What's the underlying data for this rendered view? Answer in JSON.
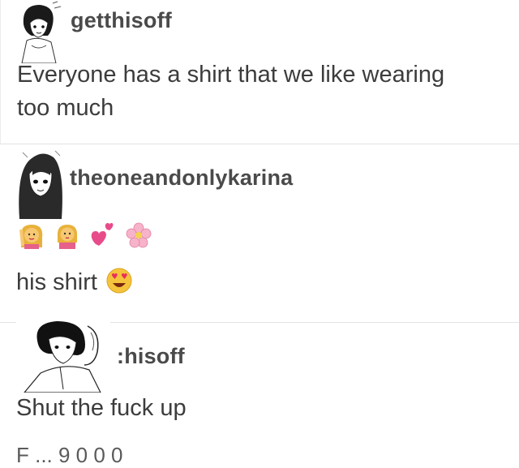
{
  "posts": [
    {
      "username": "getthisoff",
      "text": "Everyone has a shirt that we like wearing\ntoo much",
      "avatar_icon": "anime-girl-avatar-icon"
    },
    {
      "username": "theoneandonlykarina",
      "emoji_row": [
        "woman-raising-hand-icon",
        "woman-gesturing-ok-icon",
        "two-hearts-icon",
        "cherry-blossom-icon"
      ],
      "text": "his shirt",
      "inline_emoji": "heart-eyes-smiley-icon",
      "avatar_icon": "anime-girl-avatar-icon"
    },
    {
      "username": ":hisoff",
      "text": "Shut the fuck up",
      "avatar_icon": "anime-couple-avatar-icon"
    }
  ],
  "cut_off_footer": "F ... 9  0 0 0"
}
